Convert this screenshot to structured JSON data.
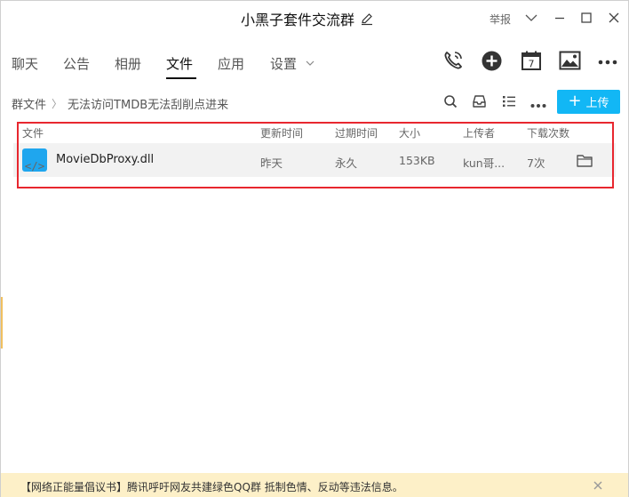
{
  "window": {
    "title": "小黑子套件交流群",
    "report_label": "举报"
  },
  "tabs": [
    {
      "label": "聊天",
      "active": false
    },
    {
      "label": "公告",
      "active": false
    },
    {
      "label": "相册",
      "active": false
    },
    {
      "label": "文件",
      "active": true
    },
    {
      "label": "应用",
      "active": false
    },
    {
      "label": "设置",
      "active": false
    }
  ],
  "toolbar_icons": [
    "phone-icon",
    "add-circle-icon",
    "calendar-icon",
    "photo-icon",
    "more-icon"
  ],
  "calendar_day": "7",
  "breadcrumb": {
    "root": "群文件",
    "separator": "〉",
    "current": "无法访问TMDB无法刮削点进来"
  },
  "upload_button": {
    "plus": "+",
    "label": "上传"
  },
  "file_table": {
    "headers": {
      "name": "文件",
      "updated": "更新时间",
      "expires": "过期时间",
      "size": "大小",
      "uploader": "上传者",
      "downloads": "下载次数"
    },
    "rows": [
      {
        "icon_glyph": "</>",
        "name": "MovieDbProxy.dll",
        "updated": "昨天",
        "expires": "永久",
        "size": "153KB",
        "uploader": "kun哥...",
        "downloads": "7次"
      }
    ]
  },
  "notice": {
    "text": "【网络正能量倡议书】腾讯呼吁网友共建绿色QQ群 抵制色情、反动等违法信息。"
  },
  "colors": {
    "accent": "#12b7f5",
    "highlight_border": "#e8272f",
    "notice_bg": "#fdf0c8",
    "file_icon": "#1fa6ee"
  }
}
